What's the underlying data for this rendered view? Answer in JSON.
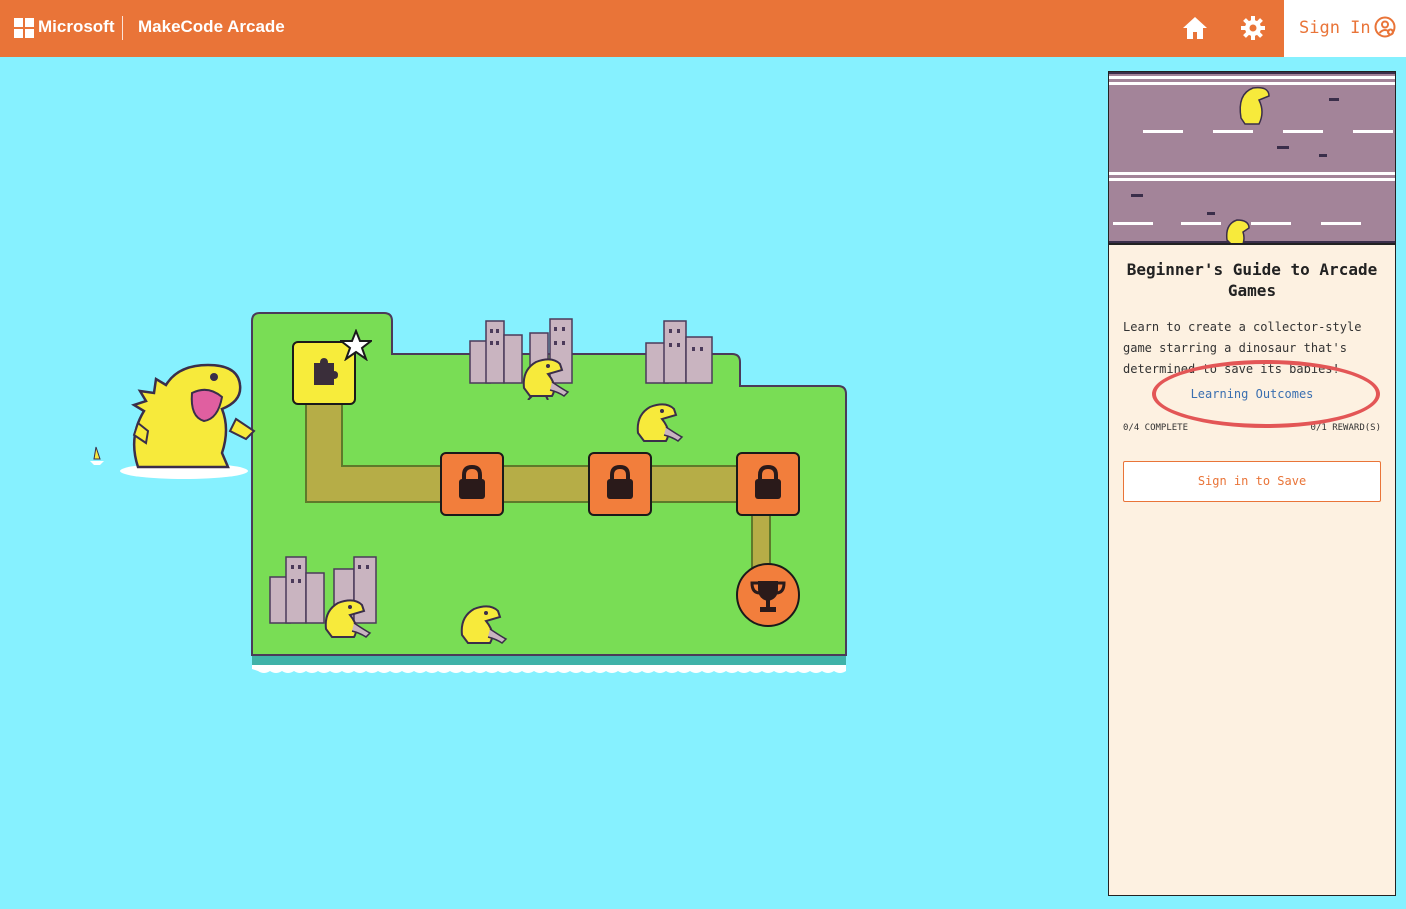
{
  "header": {
    "brand": "Microsoft",
    "app_title": "MakeCode Arcade",
    "signin_label": "Sign In",
    "icons": [
      "home-icon",
      "gear-icon",
      "account-icon"
    ]
  },
  "map": {
    "nodes": [
      {
        "name": "map-node-start",
        "state": "unlocked",
        "icon": "puzzle-icon",
        "completed_star": "star-icon"
      },
      {
        "name": "map-node-2",
        "state": "locked",
        "icon": "lock-icon"
      },
      {
        "name": "map-node-3",
        "state": "locked",
        "icon": "lock-icon"
      },
      {
        "name": "map-node-4",
        "state": "locked",
        "icon": "lock-icon"
      },
      {
        "name": "map-node-reward",
        "state": "locked",
        "icon": "trophy-icon"
      }
    ]
  },
  "panel": {
    "title": "Beginner's Guide to Arcade Games",
    "description": "Learn to create a collector-style game starring a dinosaur that's determined to save its babies!",
    "learning_outcomes_label": "Learning Outcomes",
    "progress_text": "0/4 COMPLETE",
    "rewards_text": "0/1 REWARD(S)",
    "save_button_label": "Sign in to Save"
  },
  "colors": {
    "header_bg": "#e97438",
    "map_bg": "#86f1ff",
    "grass": "#79dd55",
    "path": "#b6ad47",
    "locked_node": "#f27e3c",
    "start_node": "#f7ec3b",
    "panel_bg": "#fdf1e1",
    "annotation_oval": "#e35656"
  }
}
